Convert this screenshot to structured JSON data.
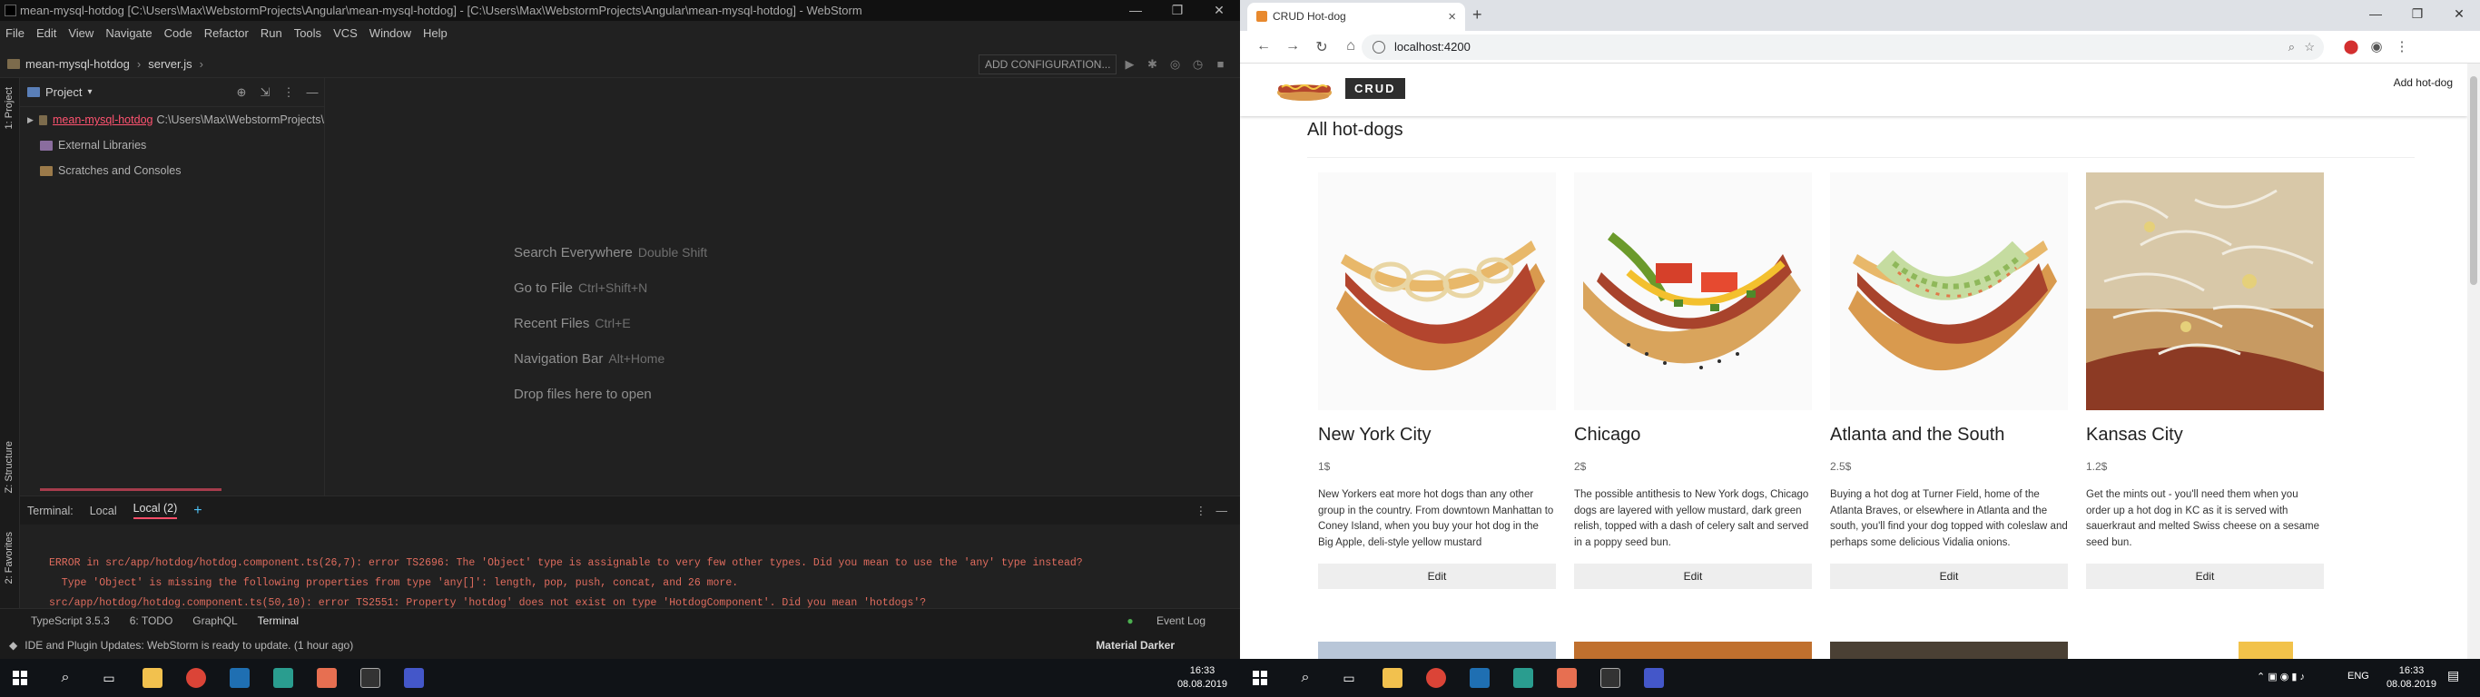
{
  "ide": {
    "title": "mean-mysql-hotdog [C:\\Users\\Max\\WebstormProjects\\Angular\\mean-mysql-hotdog] - [C:\\Users\\Max\\WebstormProjects\\Angular\\mean-mysql-hotdog] - WebStorm",
    "menu": [
      "File",
      "Edit",
      "View",
      "Navigate",
      "Code",
      "Refactor",
      "Run",
      "Tools",
      "VCS",
      "Window",
      "Help"
    ],
    "breadcrumb": [
      "mean-mysql-hotdog",
      "server.js"
    ],
    "add_configuration": "ADD CONFIGURATION...",
    "project_panel": {
      "title": "Project",
      "rows": [
        {
          "name": "mean-mysql-hotdog",
          "path": "C:\\Users\\Max\\WebstormProjects\\"
        },
        {
          "name": "External Libraries"
        },
        {
          "name": "Scratches and Consoles"
        }
      ]
    },
    "side_tabs": {
      "project": "1: Project",
      "structure": "Z: Structure",
      "favorites": "2: Favorites"
    },
    "hints": [
      {
        "label": "Search Everywhere",
        "key": "Double Shift"
      },
      {
        "label": "Go to File",
        "key": "Ctrl+Shift+N"
      },
      {
        "label": "Recent Files",
        "key": "Ctrl+E"
      },
      {
        "label": "Navigation Bar",
        "key": "Alt+Home"
      },
      {
        "label": "Drop files here to open",
        "key": ""
      }
    ],
    "terminal_tabs": [
      "Terminal:",
      "Local",
      "Local (2)"
    ],
    "terminal_lines": [
      "ERROR in src/app/hotdog/hotdog.component.ts(26,7): error TS2696: The 'Object' type is assignable to very few other types. Did you mean to use the 'any' type instead?",
      "  Type 'Object' is missing the following properties from type 'any[]': length, pop, push, concat, and 26 more.",
      "src/app/hotdog/hotdog.component.ts(50,10): error TS2551: Property 'hotdog' does not exist on type 'HotdogComponent'. Did you mean 'hotdogs'?"
    ],
    "bottom_tools": [
      "TypeScript 3.5.3",
      "6: TODO",
      "GraphQL",
      "Terminal"
    ],
    "event_log": "Event Log",
    "status": "IDE and Plugin Updates: WebStorm is ready to update. (1 hour ago)",
    "theme": "Material Darker"
  },
  "browser": {
    "tab_title": "CRUD Hot-dog",
    "url": "localhost:4200",
    "brand": "CRUD",
    "add_link": "Add hot-dog",
    "heading": "All hot-dogs",
    "edit_label": "Edit",
    "cards": [
      {
        "title": "New York City",
        "price": "1$",
        "desc": "New Yorkers eat more hot dogs than any other group in the country. From downtown Manhattan to Coney Island, when you buy your hot dog in the Big Apple, deli-style yellow mustard"
      },
      {
        "title": "Chicago",
        "price": "2$",
        "desc": "The possible antithesis to New York dogs, Chicago dogs are layered with yellow mustard, dark green relish, topped with a dash of celery salt and served in a poppy seed bun."
      },
      {
        "title": "Atlanta and the South",
        "price": "2.5$",
        "desc": "Buying a hot dog at Turner Field, home of the Atlanta Braves, or elsewhere in Atlanta and the south, you'll find your dog topped with coleslaw and perhaps some delicious Vidalia onions."
      },
      {
        "title": "Kansas City",
        "price": "1.2$",
        "desc": "Get the mints out - you'll need them when you order up a hot dog in KC as it is served with sauerkraut and melted Swiss cheese on a sesame seed bun."
      }
    ]
  },
  "taskbar": {
    "time": "16:33",
    "date": "08.08.2019",
    "lang": "ENG"
  },
  "colors": {
    "ide_bg": "#212121",
    "error_text": "#e06c5e",
    "accent_pink": "#ff4f69"
  }
}
